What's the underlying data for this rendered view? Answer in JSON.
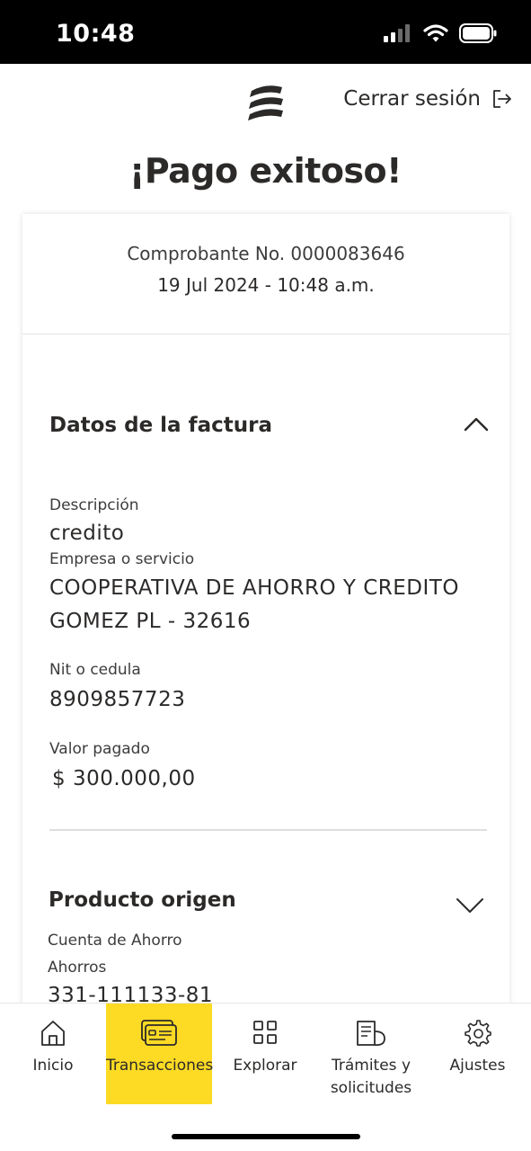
{
  "status_bar": {
    "time": "10:48"
  },
  "header": {
    "logout_label": "Cerrar sesión"
  },
  "title": "¡Pago exitoso!",
  "receipt": {
    "number": "Comprobante No. 0000083646",
    "datetime": "19 Jul 2024 - 10:48 a.m."
  },
  "invoice_section": {
    "title": "Datos de la factura",
    "expanded": true,
    "fields": [
      {
        "label": "Descripción",
        "value": "credito"
      },
      {
        "label": "Empresa o servicio",
        "value_line1": "COOPERATIVA DE AHORRO Y CREDITO",
        "value_line2": "GOMEZ PL - 32616"
      },
      {
        "label": "Nit o cedula",
        "value": "8909857723"
      },
      {
        "label": "Valor pagado",
        "value": "$ 300.000,00"
      }
    ]
  },
  "origin_section": {
    "title": "Producto origen",
    "expanded": false,
    "account_type": "Cuenta de Ahorro",
    "account_subtype": "Ahorros",
    "account_number": "331-111133-81"
  },
  "bottom_nav": {
    "items": [
      {
        "label": "Inicio",
        "icon": "home-icon",
        "active": false
      },
      {
        "label": "Transacciones",
        "icon": "card-transactions-icon",
        "active": true
      },
      {
        "label": "Explorar",
        "icon": "grid-icon",
        "active": false
      },
      {
        "label_line1": "Trámites y",
        "label_line2": "solicitudes",
        "icon": "documents-icon",
        "active": false
      },
      {
        "label": "Ajustes",
        "icon": "gear-icon",
        "active": false
      }
    ]
  },
  "colors": {
    "accent": "#fdda24",
    "text": "#2c2a29",
    "status_bar": "#000000"
  }
}
